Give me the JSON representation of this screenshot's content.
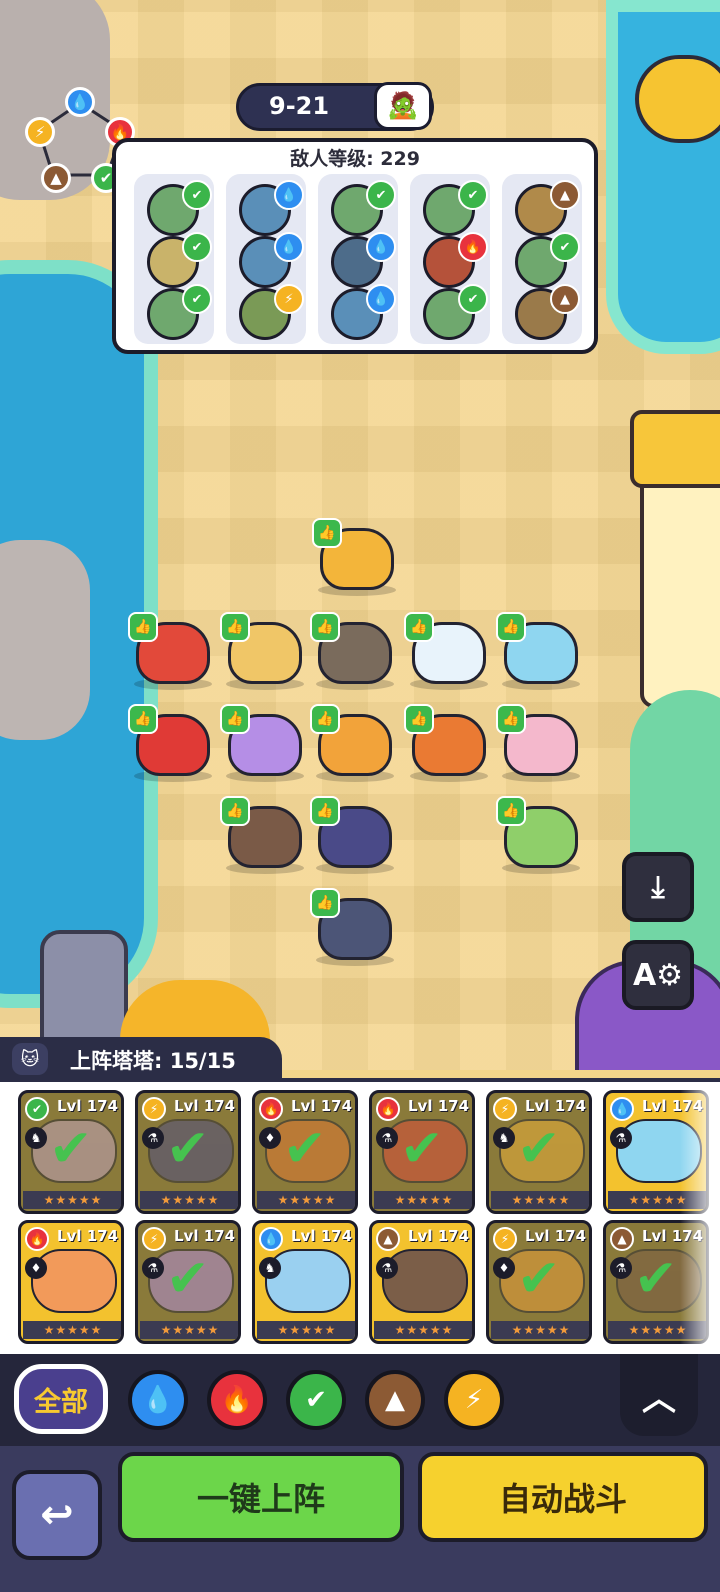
{
  "stage": {
    "label": "9-21",
    "avatar_icon": "zombie-question-icon"
  },
  "enemy_panel": {
    "level_text": "敌人等级: 229",
    "columns": [
      [
        {
          "element": "grass",
          "color": "#6fa86e"
        },
        {
          "element": "grass",
          "color": "#c9b36a"
        },
        {
          "element": "grass",
          "color": "#6fa86e"
        }
      ],
      [
        {
          "element": "water",
          "color": "#5a8fb8"
        },
        {
          "element": "water",
          "color": "#5a8fb8"
        },
        {
          "element": "light",
          "color": "#7a9a56"
        }
      ],
      [
        {
          "element": "none",
          "color": "#6fa86e"
        },
        {
          "element": "water",
          "color": "#4d6c8a"
        },
        {
          "element": "water",
          "color": "#5a8fb8"
        }
      ],
      [
        {
          "element": "grass",
          "color": "#6fa86e"
        },
        {
          "element": "fire",
          "color": "#b5523a"
        },
        {
          "element": "grass",
          "color": "#6fa86e"
        }
      ],
      [
        {
          "element": "earth",
          "color": "#b08a4a"
        },
        {
          "element": "none",
          "color": "#6fa86e"
        },
        {
          "element": "earth",
          "color": "#9a7a4a"
        }
      ]
    ]
  },
  "element_wheel": [
    "water",
    "fire",
    "grass",
    "earth",
    "light"
  ],
  "units": [
    {
      "color": "#f3b53a"
    },
    {
      "color": "#e2493a"
    },
    {
      "color": "#f0c667"
    },
    {
      "color": "#7a6b5c"
    },
    {
      "color": "#e8f3fb"
    },
    {
      "color": "#8fd6f0"
    },
    {
      "color": "#e03a36"
    },
    {
      "color": "#b58ee6"
    },
    {
      "color": "#f2a33a"
    },
    {
      "color": "#ea7a33"
    },
    {
      "color": "#f4b8cc"
    },
    {
      "color": "#7a5a47"
    },
    {
      "color": "#4a4a88"
    },
    {
      "color": "#8fcf6a"
    },
    {
      "color": "#4c5577"
    }
  ],
  "side_buttons": {
    "save_icon": "download-icon",
    "auto_settings_icon": "auto-gear-icon"
  },
  "roster": {
    "title": "上阵塔塔: 15/15",
    "cards": [
      {
        "level": "Lvl 174",
        "element": "grass",
        "selected": true,
        "art": "#c7a7c8"
      },
      {
        "level": "Lvl 174",
        "element": "light",
        "selected": true,
        "art": "#4a4a88"
      },
      {
        "level": "Lvl 174",
        "element": "fire",
        "selected": true,
        "art": "#ea7a33"
      },
      {
        "level": "Lvl 174",
        "element": "fire",
        "selected": true,
        "art": "#e2493a"
      },
      {
        "level": "Lvl 174",
        "element": "light",
        "selected": true,
        "art": "#f3b53a"
      },
      {
        "level": "Lvl 174",
        "element": "water",
        "selected": false,
        "art": "#8fd6f0"
      },
      {
        "level": "Lvl 174",
        "element": "fire",
        "selected": false,
        "art": "#f29a5a"
      },
      {
        "level": "Lvl 174",
        "element": "light",
        "selected": true,
        "art": "#b58ee6"
      },
      {
        "level": "Lvl 174",
        "element": "water",
        "selected": false,
        "art": "#9ad0f0"
      },
      {
        "level": "Lvl 174",
        "element": "earth",
        "selected": false,
        "art": "#7b5e48"
      },
      {
        "level": "Lvl 174",
        "element": "light",
        "selected": true,
        "art": "#f2a33a"
      },
      {
        "level": "Lvl 174",
        "element": "earth",
        "selected": true,
        "art": "#7a5a47"
      }
    ]
  },
  "filters": {
    "all_label": "全部",
    "elements": [
      "water",
      "fire",
      "grass",
      "earth",
      "light"
    ]
  },
  "actions": {
    "deploy_label": "一键上阵",
    "auto_battle_label": "自动战斗"
  },
  "element_colors": {
    "water": "#2e8ef0",
    "fire": "#e8323d",
    "grass": "#3bb54a",
    "earth": "#8c5a34",
    "light": "#f5b322",
    "none": "#3bb54a"
  },
  "element_glyphs": {
    "water": "💧",
    "fire": "🔥",
    "grass": "✔",
    "earth": "▲",
    "light": "⚡",
    "none": "✔"
  }
}
